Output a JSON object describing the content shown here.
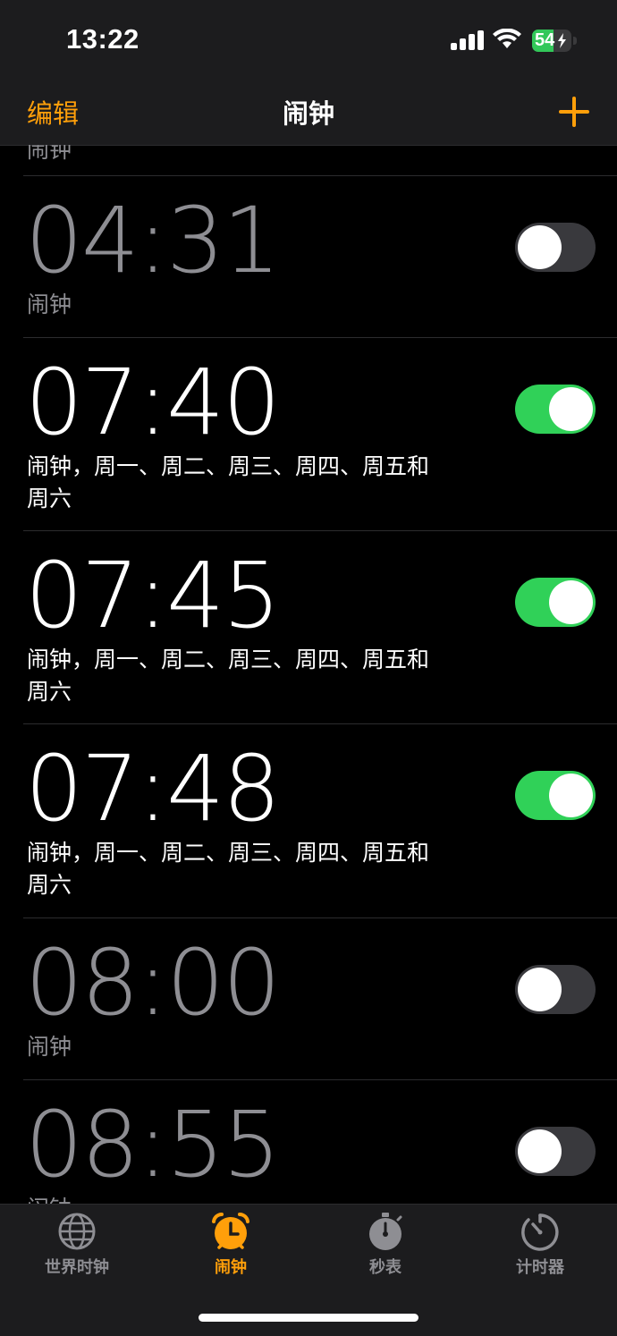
{
  "status_bar": {
    "time": "13:22",
    "battery_level": 54,
    "battery_text": "54",
    "charging": true,
    "signal_icon": "cellular-signal-icon",
    "wifi_icon": "wifi-icon",
    "colors": {
      "battery_fill": "#32c759"
    }
  },
  "nav": {
    "edit_label": "编辑",
    "title": "闹钟",
    "add_icon": "plus-icon",
    "accent_color": "#ff9f0a"
  },
  "alarms": {
    "cut_top_label": "闹钟",
    "items": [
      {
        "time": "04:31",
        "label": "闹钟",
        "enabled": false
      },
      {
        "time": "07:40",
        "label": "闹钟，周一、周二、周三、周四、周五和周六",
        "enabled": true
      },
      {
        "time": "07:45",
        "label": "闹钟，周一、周二、周三、周四、周五和周六",
        "enabled": true
      },
      {
        "time": "07:48",
        "label": "闹钟，周一、周二、周三、周四、周五和周六",
        "enabled": true
      },
      {
        "time": "08:00",
        "label": "闹钟",
        "enabled": false
      },
      {
        "time": "08:55",
        "label": "闹钟",
        "enabled": false
      }
    ],
    "colors": {
      "toggle_on": "#30d158",
      "toggle_off": "#39393d"
    }
  },
  "tabs": [
    {
      "label": "世界时钟",
      "icon": "globe-icon",
      "active": false
    },
    {
      "label": "闹钟",
      "icon": "alarm-clock-icon",
      "active": true
    },
    {
      "label": "秒表",
      "icon": "stopwatch-icon",
      "active": false
    },
    {
      "label": "计时器",
      "icon": "timer-icon",
      "active": false
    }
  ]
}
